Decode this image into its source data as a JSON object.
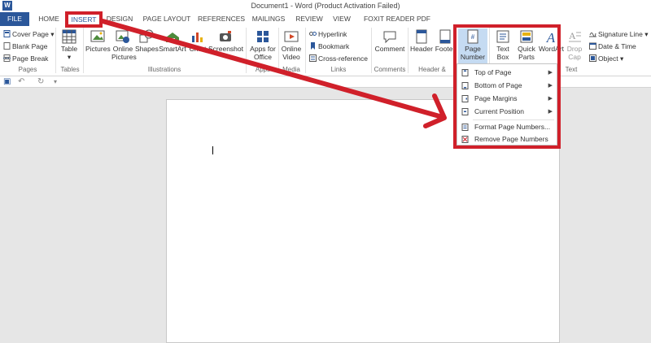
{
  "window": {
    "title": "Document1 - Word (Product Activation Failed)"
  },
  "tabs": [
    "FILE",
    "HOME",
    "INSERT",
    "DESIGN",
    "PAGE LAYOUT",
    "REFERENCES",
    "MAILINGS",
    "REVIEW",
    "VIEW",
    "FOXIT READER PDF"
  ],
  "ribbon": {
    "pages": {
      "cover_page": "Cover Page",
      "blank_page": "Blank Page",
      "page_break": "Page Break",
      "label": "Pages"
    },
    "tables": {
      "table": "Table",
      "label": "Tables"
    },
    "illustrations": {
      "pictures": "Pictures",
      "online_pictures_1": "Online",
      "online_pictures_2": "Pictures",
      "shapes": "Shapes",
      "smartart": "SmartArt",
      "chart": "Chart",
      "screenshot": "Screenshot",
      "label": "Illustrations"
    },
    "apps": {
      "apps_1": "Apps for",
      "apps_2": "Office",
      "label": "Apps"
    },
    "media": {
      "online_video_1": "Online",
      "online_video_2": "Video",
      "label": "Media"
    },
    "links": {
      "hyperlink": "Hyperlink",
      "bookmark": "Bookmark",
      "cross_reference": "Cross-reference",
      "label": "Links"
    },
    "comments": {
      "comment": "Comment",
      "label": "Comments"
    },
    "header_footer": {
      "header": "Header",
      "footer": "Footer",
      "page_number_1": "Page",
      "page_number_2": "Number",
      "label": "Header &"
    },
    "text": {
      "text_box_1": "Text",
      "text_box_2": "Box",
      "quick_parts_1": "Quick",
      "quick_parts_2": "Parts",
      "wordart": "WordArt",
      "drop_cap_1": "Drop",
      "drop_cap_2": "Cap",
      "signature_line": "Signature Line",
      "date_time": "Date & Time",
      "object": "Object",
      "label": "Text"
    }
  },
  "page_number_menu": {
    "items": [
      "Top of Page",
      "Bottom of Page",
      "Page Margins",
      "Current Position",
      "Format Page Numbers...",
      "Remove Page Numbers"
    ]
  },
  "colors": {
    "accent": "#2b579a",
    "highlight": "#d0202a"
  }
}
